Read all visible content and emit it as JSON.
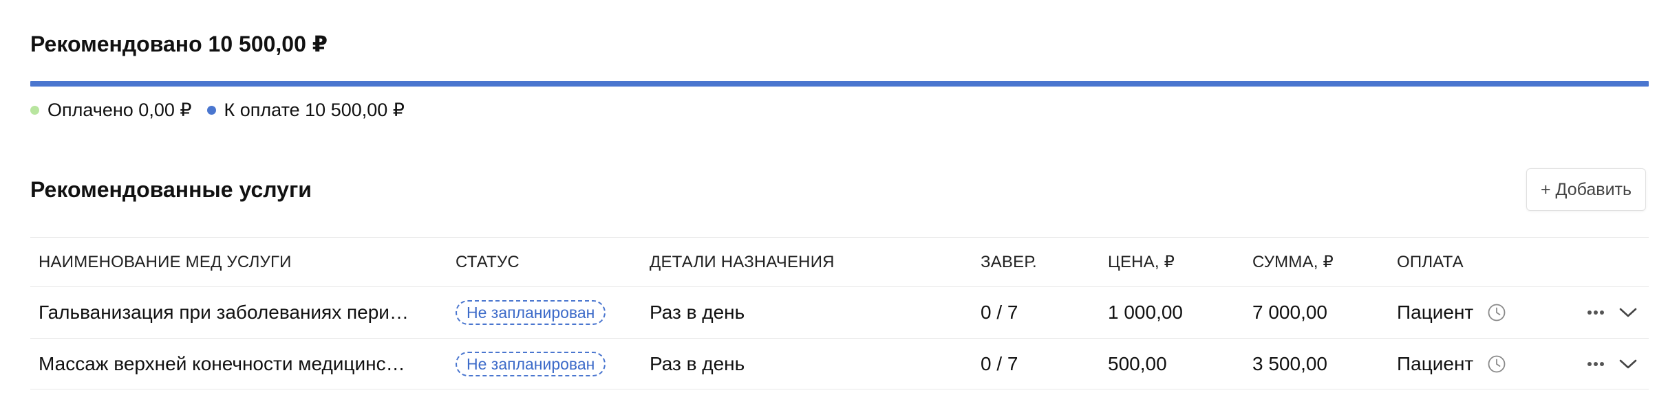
{
  "summary": {
    "title": "Рекомендовано 10 500,00 ₽",
    "paid_fraction": 0,
    "legend": [
      {
        "label": "Оплачено 0,00 ₽",
        "color": "#b8e59f"
      },
      {
        "label": "К оплате 10 500,00 ₽",
        "color": "#4a76cf"
      }
    ]
  },
  "services": {
    "title": "Рекомендованные услуги",
    "add_label": "+ Добавить",
    "columns": [
      "НАИМЕНОВАНИЕ МЕД УСЛУГИ",
      "СТАТУС",
      "ДЕТАЛИ НАЗНАЧЕНИЯ",
      "ЗАВЕР.",
      "ЦЕНА, ₽",
      "СУММА, ₽",
      "ОПЛАТА"
    ],
    "rows": [
      {
        "name": "Гальванизация при заболеваниях пери…",
        "status": "Не запланирован",
        "details": "Раз в день",
        "done": "0 / 7",
        "price": "1 000,00",
        "sum": "7 000,00",
        "payment": "Пациент"
      },
      {
        "name": "Массаж верхней конечности медицинс…",
        "status": "Не запланирован",
        "details": "Раз в день",
        "done": "0 / 7",
        "price": "500,00",
        "sum": "3 500,00",
        "payment": "Пациент"
      }
    ]
  },
  "icons": {
    "clock": "clock-icon",
    "more": "more-icon",
    "expand": "chevron-down-icon"
  },
  "colors": {
    "accent": "#4a76cf",
    "paid": "#b8e59f",
    "border": "#e7e7e7"
  }
}
